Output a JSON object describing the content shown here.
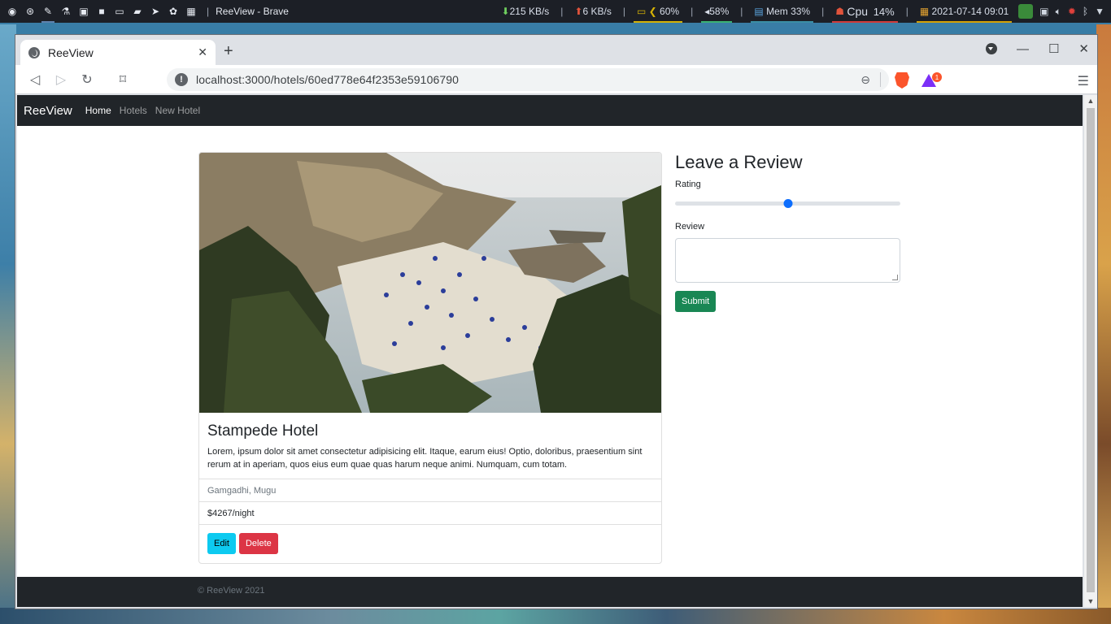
{
  "taskbar": {
    "window_title": "ReeView - Brave",
    "separator": "|",
    "net_down": "215 KB/s",
    "net_up": "6 KB/s",
    "battery": "60%",
    "volume": "58%",
    "memory": "Mem 33%",
    "cpu_label": "Cpu",
    "cpu_value": "14%",
    "datetime": "2021-07-14 09:01",
    "launcher_icons": [
      "brave-icon",
      "vpn-icon",
      "pen-icon",
      "flask-icon",
      "image-icon",
      "video-icon",
      "laptop-icon",
      "folder-icon",
      "telegram-icon",
      "paw-icon",
      "grid-icon"
    ],
    "tray_icons": [
      "avatar-icon",
      "screenshot-icon",
      "speaker-icon",
      "settings-bug-icon",
      "bluetooth-icon",
      "wifi-icon"
    ]
  },
  "browser": {
    "tab_title": "ReeView",
    "tab_close": "✕",
    "new_tab": "+",
    "url": "localhost:3000/hotels/60ed778e64f2353e59106790",
    "rewards_badge": "1"
  },
  "site": {
    "brand": "ReeView",
    "nav": [
      {
        "label": "Home",
        "active": true
      },
      {
        "label": "Hotels",
        "active": false
      },
      {
        "label": "New Hotel",
        "active": false
      }
    ],
    "hotel": {
      "title": "Stampede Hotel",
      "description": "Lorem, ipsum dolor sit amet consectetur adipisicing elit. Itaque, earum eius! Optio, doloribus, praesentium sint rerum at in aperiam, quos eius eum quae quas harum neque animi. Numquam, cum totam.",
      "location": "Gamgadhi, Mugu",
      "price": "$4267/night",
      "edit_label": "Edit",
      "delete_label": "Delete"
    },
    "review_form": {
      "heading": "Leave a Review",
      "rating_label": "Rating",
      "rating_value_fraction": 0.5,
      "review_label": "Review",
      "review_value": "",
      "submit_label": "Submit"
    },
    "footer": "© ReeView 2021"
  }
}
